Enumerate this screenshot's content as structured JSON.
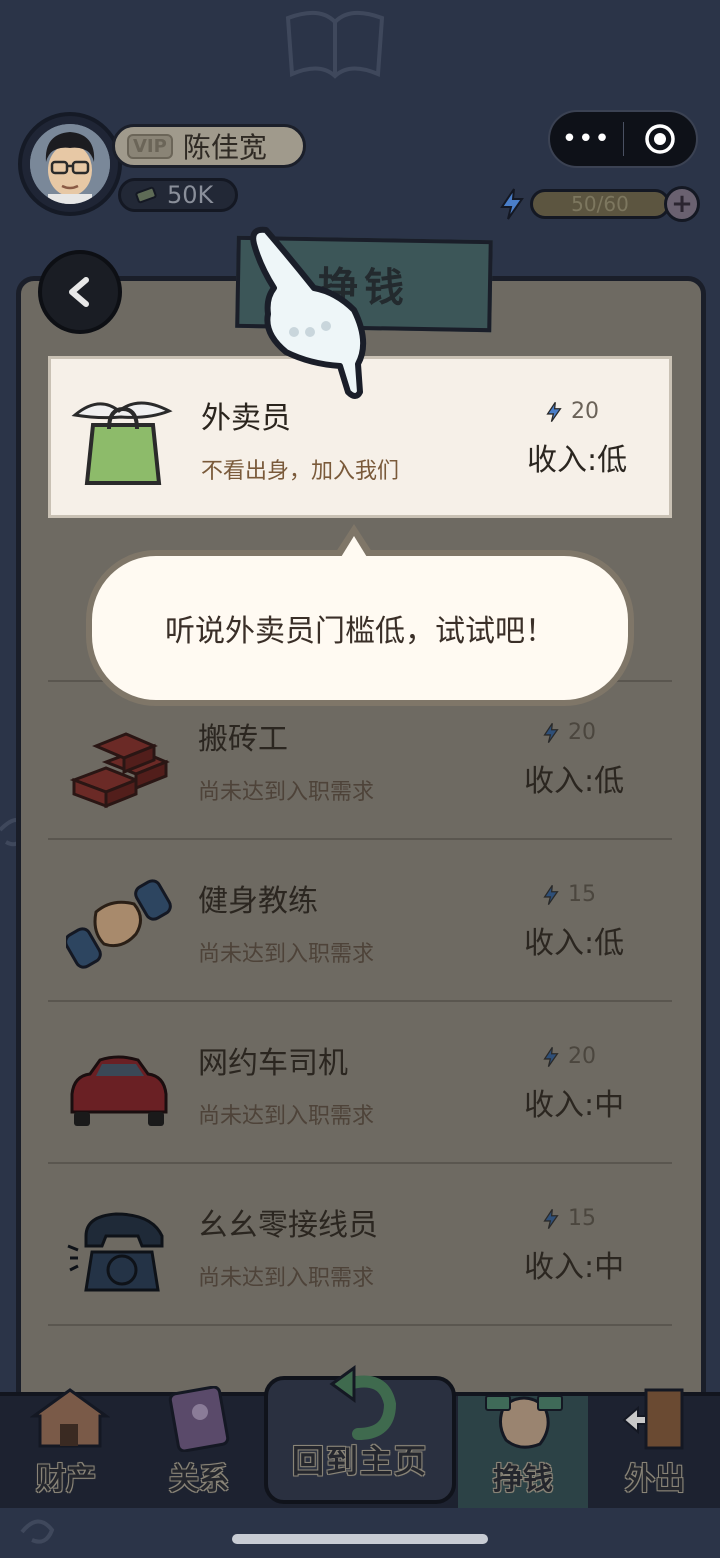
{
  "player": {
    "vip_label": "VIP",
    "name": "陈佳宽",
    "money": "50K"
  },
  "capsule": {
    "menu_glyph": "•••"
  },
  "energy": {
    "value": 50,
    "max": 60,
    "text": "50/60",
    "plus": "+"
  },
  "panel": {
    "title": "挣钱"
  },
  "jobs": [
    {
      "name": "外卖员",
      "desc": "不看出身，加入我们",
      "cost": "20",
      "income": "收入:低"
    },
    {
      "name": "搬砖工",
      "desc": "尚未达到入职需求",
      "cost": "20",
      "income": "收入:低"
    },
    {
      "name": "健身教练",
      "desc": "尚未达到入职需求",
      "cost": "15",
      "income": "收入:低"
    },
    {
      "name": "网约车司机",
      "desc": "尚未达到入职需求",
      "cost": "20",
      "income": "收入:中"
    },
    {
      "name": "幺幺零接线员",
      "desc": "尚未达到入职需求",
      "cost": "15",
      "income": "收入:中"
    }
  ],
  "bubble": {
    "text": "听说外卖员门槛低，试试吧！"
  },
  "nav": {
    "assets": "财产",
    "relations": "关系",
    "home": "回到主页",
    "earn": "挣钱",
    "out": "外出"
  },
  "icons": {
    "back": "back-arrow-icon",
    "energy": "lightning-icon",
    "money": "cash-icon"
  },
  "colors": {
    "background": "#2b3448",
    "energy_fill": "#5c5540",
    "active_row": "#f6f0e8"
  }
}
